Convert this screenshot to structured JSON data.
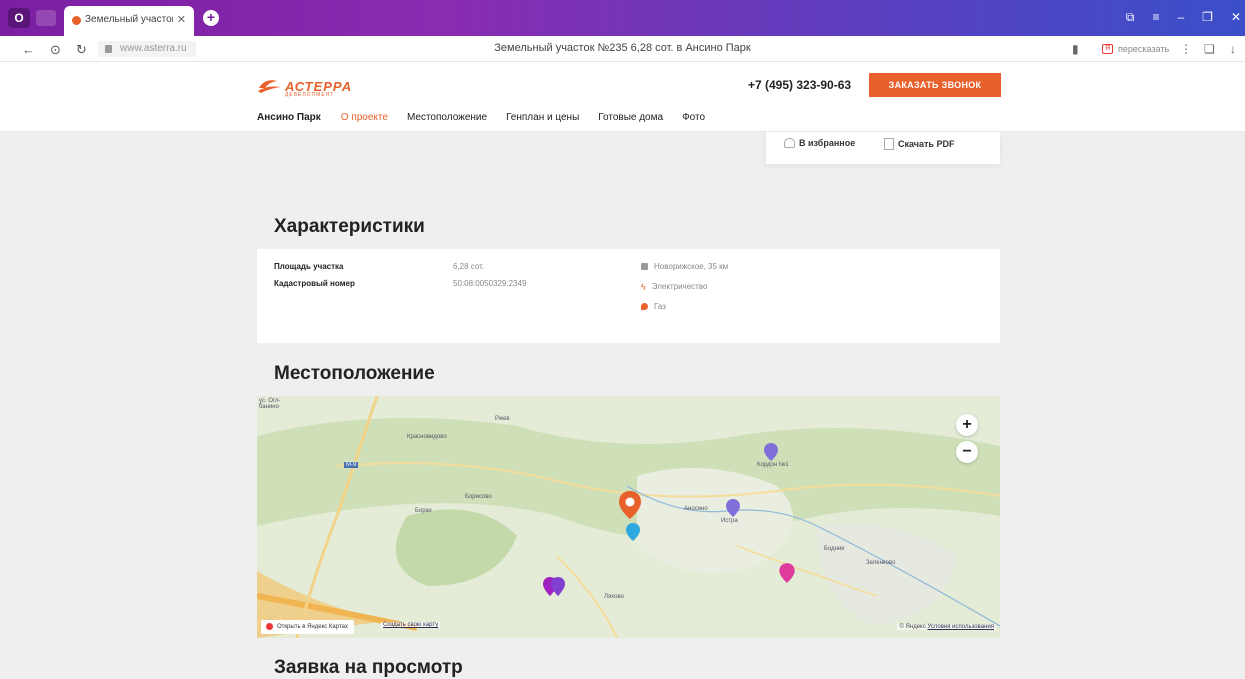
{
  "browser": {
    "opera_label": "O",
    "tab_title": "Земельный участок №",
    "tab_close": "✕",
    "new_tab": "+",
    "address": "www.asterra.ru",
    "page_title": "Земельный участок №235 6,28 сот. в Ансино Парк",
    "translate_label": "пересказать",
    "translate_badge": "Я"
  },
  "site": {
    "logo_text": "АСТЕРРА",
    "logo_sub": "ДЕВЕЛОПМЕНТ",
    "phone": "+7 (495) 323-90-63",
    "call_button": "ЗАКАЗАТЬ ЗВОНОК",
    "menu": {
      "brand": "Ансино Парк",
      "about": "О проекте",
      "location": "Местоположение",
      "plan": "Генплан и цены",
      "houses": "Готовые дома",
      "photo": "Фото"
    }
  },
  "actions": {
    "favorite": "В избранное",
    "pdf": "Скачать PDF"
  },
  "characteristics": {
    "heading": "Характеристики",
    "area_label": "Площадь участка",
    "area_value": "6,28 сот.",
    "cadastral_label": "Кадастровый номер",
    "cadastral_value": "50:08:0050329:2349",
    "features": {
      "highway": "Новорижское, 35 км",
      "power": "Электричество",
      "gas": "Газ"
    },
    "colors": {
      "power": "#e8602c",
      "gas": "#e8602c",
      "highway": "#9a9a9a"
    }
  },
  "map_section": {
    "heading": "Местоположение",
    "labels": {
      "corner": "ус. Огл-\nбанино",
      "krasnovidovo": "Красновидово",
      "ryzhe": "Ржев",
      "borisovo": "Борисово",
      "borki": "Борки",
      "anosino": "Аносино",
      "istra": "Истра",
      "kordon": "Кордон №1",
      "bodnie": "Бодние",
      "zelenkovo": "Зеленково",
      "lyakhovo": "Ляхово",
      "road": "М-9"
    },
    "zoom_in": "+",
    "zoom_out": "−",
    "open_yandex": "Открыть в Яндекс Картах",
    "make_map": "Создать свою карту",
    "copyright": "© Яндекс",
    "terms": "Условия использования"
  },
  "request_section": {
    "heading": "Заявка на просмотр"
  },
  "theme": {
    "accent": "#e8602c"
  }
}
